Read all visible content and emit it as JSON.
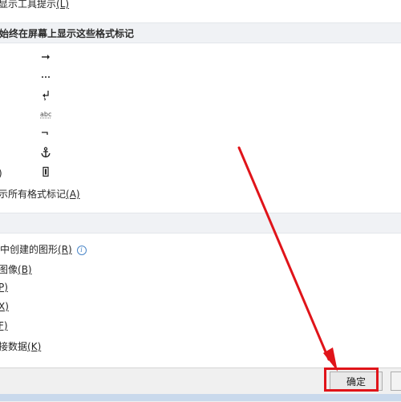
{
  "top_row": {
    "label": "显示工具提示",
    "hotkey": "(L)"
  },
  "format_section": {
    "header": "始终在屏幕上显示这些格式标记",
    "marks": [
      {
        "icon": "tab-arrow-icon",
        "glyph": "→"
      },
      {
        "icon": "space-dots-icon",
        "glyph": "···"
      },
      {
        "icon": "paragraph-mark-icon",
        "glyph": "↲"
      },
      {
        "icon": "hidden-text-icon",
        "glyph": "abc"
      },
      {
        "icon": "optional-hyphen-icon",
        "glyph": "¬"
      },
      {
        "icon": "object-anchor-icon",
        "glyph": "⚓"
      },
      {
        "icon": "dashed-box-icon",
        "glyph": "▯"
      }
    ],
    "truncated_paren": ")",
    "all_marks_label": "示所有格式标记",
    "all_marks_hotkey": "(A)"
  },
  "print_section": {
    "header": "",
    "items": [
      {
        "label": "中创建的图形",
        "hotkey": "(R)",
        "has_info": true
      },
      {
        "label": "图像",
        "hotkey": "(B)"
      },
      {
        "label": "",
        "hotkey": "P)"
      },
      {
        "label": "",
        "hotkey": "X)"
      },
      {
        "label": "",
        "hotkey": "F)"
      },
      {
        "label": "接数据",
        "hotkey": "(K)"
      }
    ]
  },
  "buttons": {
    "ok": "确定"
  },
  "colors": {
    "annotation_red": "#e0141a",
    "header_bg": "#f0f2f5",
    "info_blue": "#4a86c8"
  }
}
